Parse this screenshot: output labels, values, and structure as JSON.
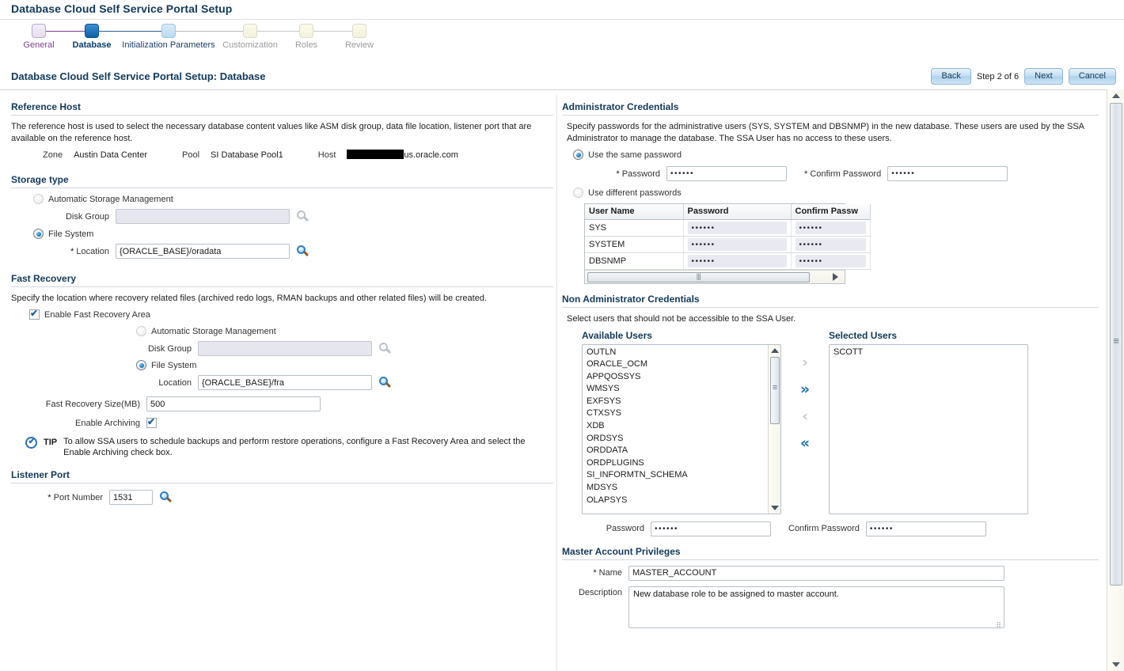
{
  "app": {
    "title": "Database Cloud Self Service Portal Setup"
  },
  "train": {
    "steps": [
      {
        "label": "General",
        "state": "visited"
      },
      {
        "label": "Database",
        "state": "current"
      },
      {
        "label": "Initialization Parameters",
        "state": "next"
      },
      {
        "label": "Customization",
        "state": "future"
      },
      {
        "label": "Roles",
        "state": "future"
      },
      {
        "label": "Review",
        "state": "future"
      }
    ]
  },
  "header": {
    "page_title": "Database Cloud Self Service Portal Setup: Database",
    "back_label": "Back",
    "step_text": "Step 2 of 6",
    "next_label": "Next",
    "cancel_label": "Cancel"
  },
  "reference_host": {
    "title": "Reference Host",
    "description": "The reference host is used to select the necessary database content values like ASM disk group, data file location, listener port that are available on the reference host.",
    "zone_label": "Zone",
    "zone_value": "Austin Data Center",
    "pool_label": "Pool",
    "pool_value": "SI Database Pool1",
    "host_label": "Host",
    "host_value_suffix": "us.oracle.com"
  },
  "storage_type": {
    "title": "Storage type",
    "asm_label": "Automatic Storage Management",
    "asm_selected": false,
    "disk_group_label": "Disk Group",
    "disk_group_value": "",
    "filesystem_label": "File System",
    "filesystem_selected": true,
    "location_label": "Location",
    "location_required": "*",
    "location_value": "{ORACLE_BASE}/oradata"
  },
  "fast_recovery": {
    "title": "Fast Recovery",
    "description": "Specify the location where recovery related files (archived redo logs, RMAN backups and other related files) will be created.",
    "enable_label": "Enable Fast Recovery Area",
    "enable_checked": true,
    "asm_label": "Automatic Storage Management",
    "asm_selected": false,
    "disk_group_label": "Disk Group",
    "disk_group_value": "",
    "filesystem_label": "File System",
    "filesystem_selected": true,
    "location_label": "Location",
    "location_value": "{ORACLE_BASE}/fra",
    "size_label": "Fast Recovery Size(MB)",
    "size_value": "500",
    "archiving_label": "Enable Archiving",
    "archiving_checked": true
  },
  "tip": {
    "word": "TIP",
    "text": "To allow SSA users to schedule backups and perform restore operations, configure a Fast Recovery Area and select the Enable Archiving check box."
  },
  "listener_port": {
    "title": "Listener Port",
    "port_label": "Port Number",
    "port_required": "*",
    "port_value": "1531"
  },
  "admin_credentials": {
    "title": "Administrator Credentials",
    "description": "Specify passwords for the administrative users (SYS, SYSTEM and DBSNMP) in the new database. These users are used by the SSA Administrator to manage the database. The SSA User has no access to these users.",
    "same_password_label": "Use the same password",
    "same_password_selected": true,
    "password_label": "Password",
    "password_required": "*",
    "password_value": "••••••",
    "confirm_label": "Confirm Password",
    "confirm_required": "*",
    "confirm_value": "••••••",
    "different_password_label": "Use different passwords",
    "different_password_selected": false,
    "table": {
      "columns": [
        "User Name",
        "Password",
        "Confirm Passw"
      ],
      "rows": [
        {
          "user": "SYS",
          "password": "••••••",
          "confirm": "••••••"
        },
        {
          "user": "SYSTEM",
          "password": "••••••",
          "confirm": "••••••"
        },
        {
          "user": "DBSNMP",
          "password": "••••••",
          "confirm": "••••••"
        }
      ]
    }
  },
  "non_admin_credentials": {
    "title": "Non Administrator Credentials",
    "description": "Select users that should not be accessible to the SSA User.",
    "available_label": "Available Users",
    "selected_label": "Selected Users",
    "available_users": [
      "OUTLN",
      "ORACLE_OCM",
      "APPQOSSYS",
      "WMSYS",
      "EXFSYS",
      "CTXSYS",
      "XDB",
      "ORDSYS",
      "ORDDATA",
      "ORDPLUGINS",
      "SI_INFORMTN_SCHEMA",
      "MDSYS",
      "OLAPSYS"
    ],
    "selected_users": [
      "SCOTT"
    ],
    "shuttle": {
      "move_right": "›",
      "move_all_right": "»",
      "move_left": "‹",
      "move_all_left": "«"
    },
    "password_label": "Password",
    "password_value": "••••••",
    "confirm_label": "Confirm Password",
    "confirm_value": "••••••"
  },
  "master_account": {
    "title": "Master Account Privileges",
    "name_label": "Name",
    "name_required": "*",
    "name_value": "MASTER_ACCOUNT",
    "description_label": "Description",
    "description_value": "New database role to be assigned to master account."
  },
  "colors": {
    "heading": "#12395b",
    "accent": "#1b72c4",
    "visited": "#7b3f8f"
  }
}
